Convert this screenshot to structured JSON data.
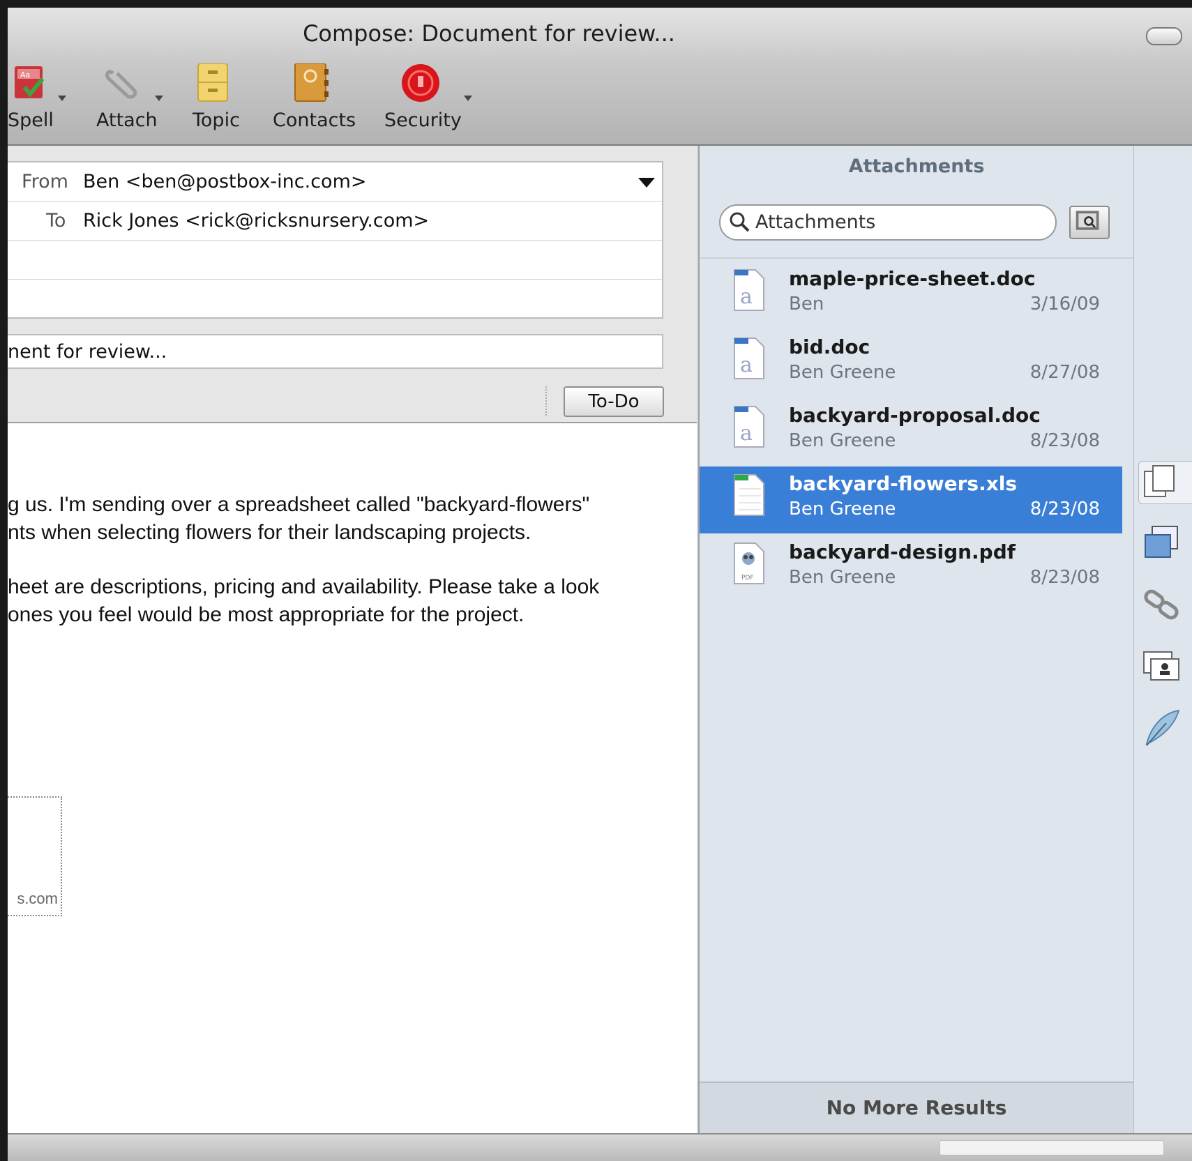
{
  "window": {
    "title": "Compose: Document for review..."
  },
  "toolbar": {
    "spell_label": "Spell",
    "attach_label": "Attach",
    "topic_label": "Topic",
    "contacts_label": "Contacts",
    "security_label": "Security"
  },
  "headers": {
    "from_label": "From",
    "from_value": "Ben <ben@postbox-inc.com>",
    "to_label": "To",
    "to_value": "Rick Jones <rick@ricksnursery.com>",
    "subject_value": "nent for review...",
    "todo_label": "To-Do"
  },
  "body": {
    "lines": [
      "g us.  I'm sending over a spreadsheet called \"backyard-flowers\"",
      "nts when selecting flowers for their landscaping projects.",
      "heet are descriptions, pricing and availability.  Please take a look",
      "ones you feel would be most appropriate for the project."
    ],
    "signature_fragment": "s.com"
  },
  "attachments": {
    "title": "Attachments",
    "search_placeholder": "Attachments",
    "items": [
      {
        "name": "maple-price-sheet.doc",
        "author": "Ben",
        "date": "3/16/09",
        "type": "doc",
        "selected": false
      },
      {
        "name": "bid.doc",
        "author": "Ben Greene",
        "date": "8/27/08",
        "type": "doc",
        "selected": false
      },
      {
        "name": "backyard-proposal.doc",
        "author": "Ben Greene",
        "date": "8/23/08",
        "type": "doc",
        "selected": false
      },
      {
        "name": "backyard-flowers.xls",
        "author": "Ben Greene",
        "date": "8/23/08",
        "type": "xls",
        "selected": true
      },
      {
        "name": "backyard-design.pdf",
        "author": "Ben Greene",
        "date": "8/23/08",
        "type": "pdf",
        "selected": false
      }
    ],
    "footer": "No More Results"
  },
  "colors": {
    "selection": "#3a7fd7",
    "pane_bg": "#dfe5ec",
    "security_red": "#d9151c"
  }
}
